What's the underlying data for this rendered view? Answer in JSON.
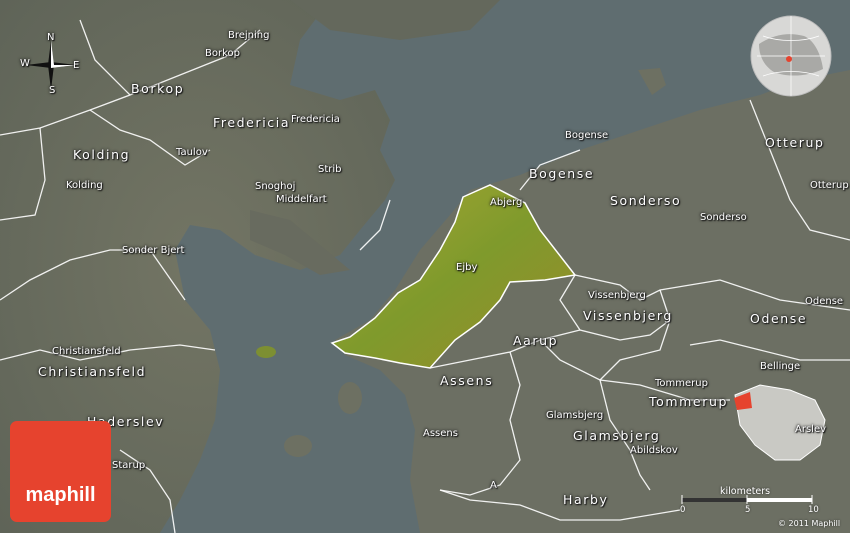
{
  "brand": {
    "logo_text": "maphill",
    "accent": "#e6432e"
  },
  "colors": {
    "water": "#5f6f72",
    "land": "#6e7164",
    "highlight": "#8a9a2a",
    "border": "#ffffff"
  },
  "compass": {
    "n": "N",
    "s": "S",
    "e": "E",
    "w": "W"
  },
  "places": {
    "brejning": "Brejning",
    "borkop_small": "Borkop",
    "borkop": "Borkop",
    "fredericia": "Fredericia",
    "fredericia_small": "Fredericia",
    "kolding": "Kolding",
    "kolding_small": "Kolding",
    "taulov": "Taulov",
    "strib": "Strib",
    "snoghoj": "Snoghoj",
    "middelfart": "Middelfart",
    "sonder_bjert": "Sonder Bjert",
    "bogense_small": "Bogense",
    "bogense": "Bogense",
    "abjerg": "Abjerg",
    "sonderso": "Sonderso",
    "sonderso_small": "Sonderso",
    "otterup": "Otterup",
    "otterup_small": "Otterup",
    "ejby": "Ejby",
    "vissenbjerg_small": "Vissenbjerg",
    "vissenbjerg": "Vissenbjerg",
    "odense_small": "Odense",
    "odense": "Odense",
    "aarup": "Aarup",
    "christiansfeld_small": "Christiansfeld",
    "christiansfeld": "Christiansfeld",
    "assens": "Assens",
    "assens_small": "Assens",
    "bellinge": "Bellinge",
    "tommerup_small": "Tommerup",
    "tommerup": "Tommerup",
    "haderslev": "Haderslev",
    "glamsbjerg_small": "Glamsbjerg",
    "glamsbjerg": "Glamsbjerg",
    "abildskov": "Abildskov",
    "arslev": "Arslev",
    "starup": "Starup",
    "harby": "Harby",
    "a_small": "A"
  },
  "scale": {
    "title": "kilometers",
    "ticks": [
      "0",
      "5",
      "10"
    ]
  },
  "copyright": "© 2011 Maphill"
}
